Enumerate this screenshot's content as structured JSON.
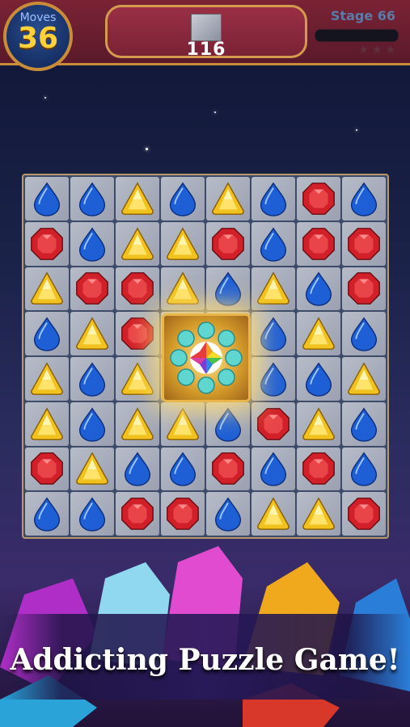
{
  "hud": {
    "moves_label": "Moves",
    "moves_value": "36",
    "target_count": "116",
    "stage_label": "Stage 66",
    "star_rating": 0
  },
  "board": {
    "rows": [
      [
        "blue",
        "blue",
        "yellow",
        "blue",
        "yellow",
        "blue",
        "red",
        "blue"
      ],
      [
        "red",
        "blue",
        "yellow",
        "yellow",
        "red",
        "blue",
        "red",
        "red"
      ],
      [
        "yellow",
        "red",
        "red",
        "yellow",
        "blue",
        "yellow",
        "blue",
        "red"
      ],
      [
        "blue",
        "yellow",
        "red",
        "special",
        "special",
        "blue",
        "yellow",
        "blue"
      ],
      [
        "yellow",
        "blue",
        "yellow",
        "special",
        "special",
        "blue",
        "blue",
        "yellow"
      ],
      [
        "yellow",
        "blue",
        "yellow",
        "yellow",
        "blue",
        "red",
        "yellow",
        "blue"
      ],
      [
        "red",
        "yellow",
        "blue",
        "blue",
        "red",
        "blue",
        "red",
        "blue"
      ],
      [
        "blue",
        "blue",
        "red",
        "red",
        "blue",
        "yellow",
        "yellow",
        "red"
      ]
    ]
  },
  "colors": {
    "blue": "#1e5fd6",
    "red": "#d1202a",
    "yellow": "#f1c21d",
    "hud_bg": "#6b1e30",
    "accent_gold": "#c98d3a"
  },
  "banner": {
    "text": "Addicting Puzzle Game!"
  }
}
